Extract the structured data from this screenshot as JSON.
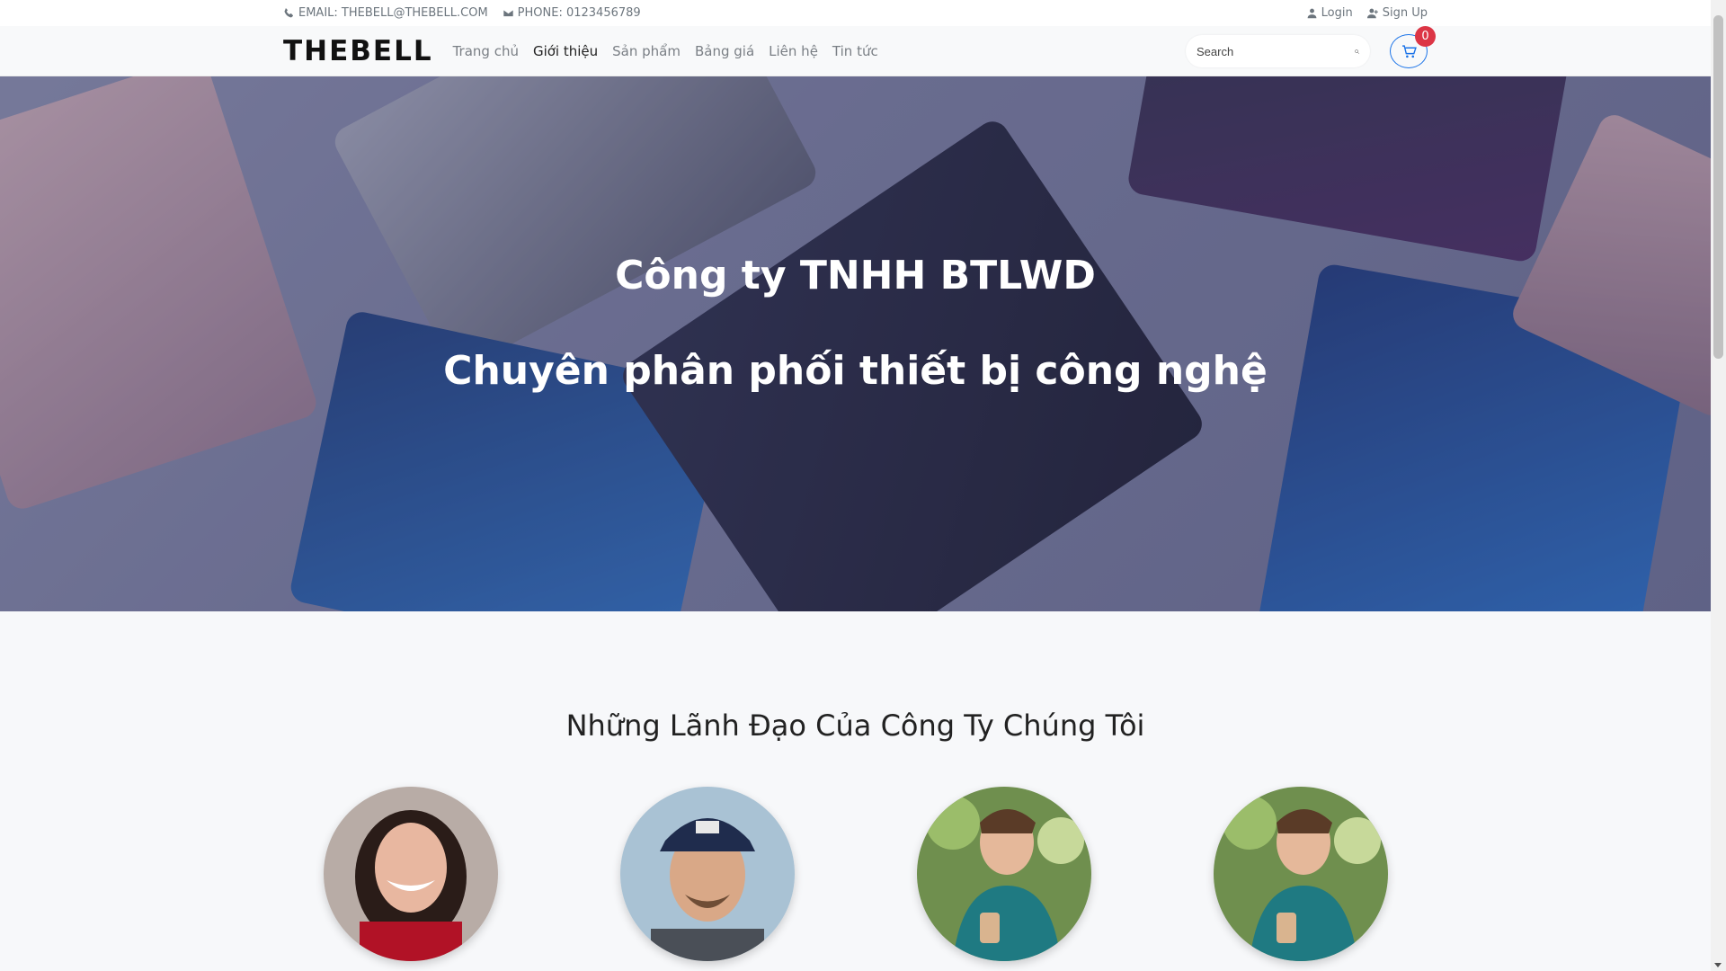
{
  "topbar": {
    "email": "EMAIL: THEBELL@THEBELL.COM",
    "phone": "PHONE: 0123456789",
    "login": "Login",
    "signup": "Sign Up"
  },
  "navbar": {
    "brand": "THEBELL",
    "menu": [
      "Trang chủ",
      "Giới thiệu",
      "Sản phẩm",
      "Bảng giá",
      "Liên hệ",
      "Tin tức"
    ],
    "active_menu": "Giới thiệu",
    "search_placeholder": "Search",
    "cart_count": "0"
  },
  "hero": {
    "title": "Công ty TNHH BTLWD",
    "subtitle": "Chuyên phân phối thiết bị công nghệ"
  },
  "leaders": {
    "heading": "Những Lãnh Đạo Của Công Ty Chúng Tôi"
  },
  "colors": {
    "accent": "#1a73e8",
    "badge": "#dc3545"
  }
}
